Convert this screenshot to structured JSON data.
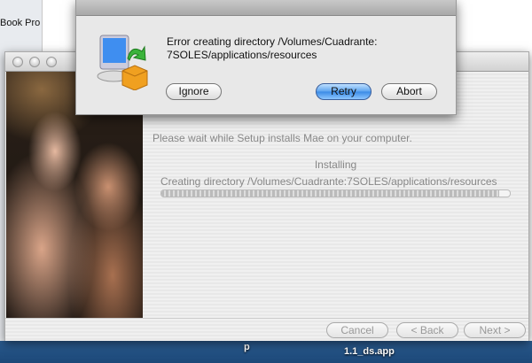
{
  "background": {
    "finder_sidebar_item": "Book Pro",
    "desktop_labels": [
      "p",
      "1.1_ds.app"
    ]
  },
  "installer": {
    "message": "Please wait while Setup installs Mae on your computer.",
    "status": "Installing",
    "detail": "Creating directory /Volumes/Cuadrante:7SOLES/applications/resources",
    "progress_percent": 97,
    "buttons": {
      "cancel": "Cancel",
      "back": "< Back",
      "next": "Next >"
    }
  },
  "error_sheet": {
    "message_line1": "Error creating directory /Volumes/Cuadrante:",
    "message_line2": "7SOLES/applications/resources",
    "buttons": {
      "ignore": "Ignore",
      "retry": "Retry",
      "abort": "Abort"
    },
    "default_button_color": "#4a94ea"
  }
}
